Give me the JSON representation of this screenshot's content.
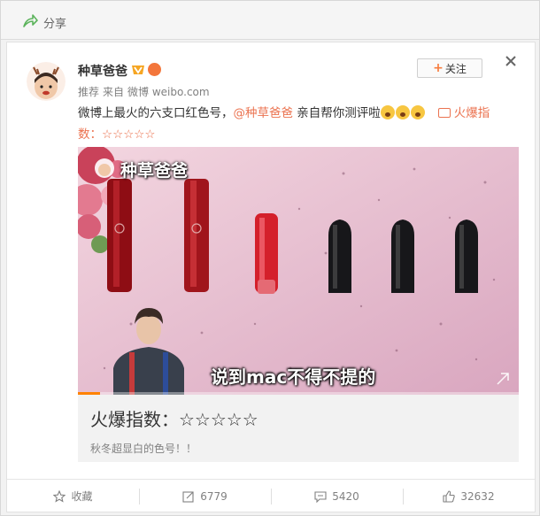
{
  "topbar": {
    "title": "分享",
    "icon": "share-icon"
  },
  "post": {
    "author": "种草爸爸",
    "meta": {
      "tag": "推荐",
      "source_prefix": "来自",
      "source": "微博 weibo.com"
    },
    "follow_label": "关注",
    "text_before": "微博上最火的六支口红色号，",
    "mention": "@种草爸爸",
    "text_after": " 亲自帮你测评啦",
    "link_text": "火爆指",
    "line2_prefix": "数：",
    "stars": "☆☆☆☆☆"
  },
  "media": {
    "watermark": "种草爸爸",
    "subtitle": "说到mac不得不提的",
    "progress_fraction": 0.05
  },
  "card_footer": {
    "title": "火爆指数：☆☆☆☆☆",
    "desc": "秋冬超显白的色号！！"
  },
  "actions": {
    "favorite": "收藏",
    "repost": "6779",
    "comment": "5420",
    "like": "32632"
  },
  "colors": {
    "accent": "#eb7350",
    "follow_plus": "#f77c3d",
    "progress": "#ff8200"
  }
}
